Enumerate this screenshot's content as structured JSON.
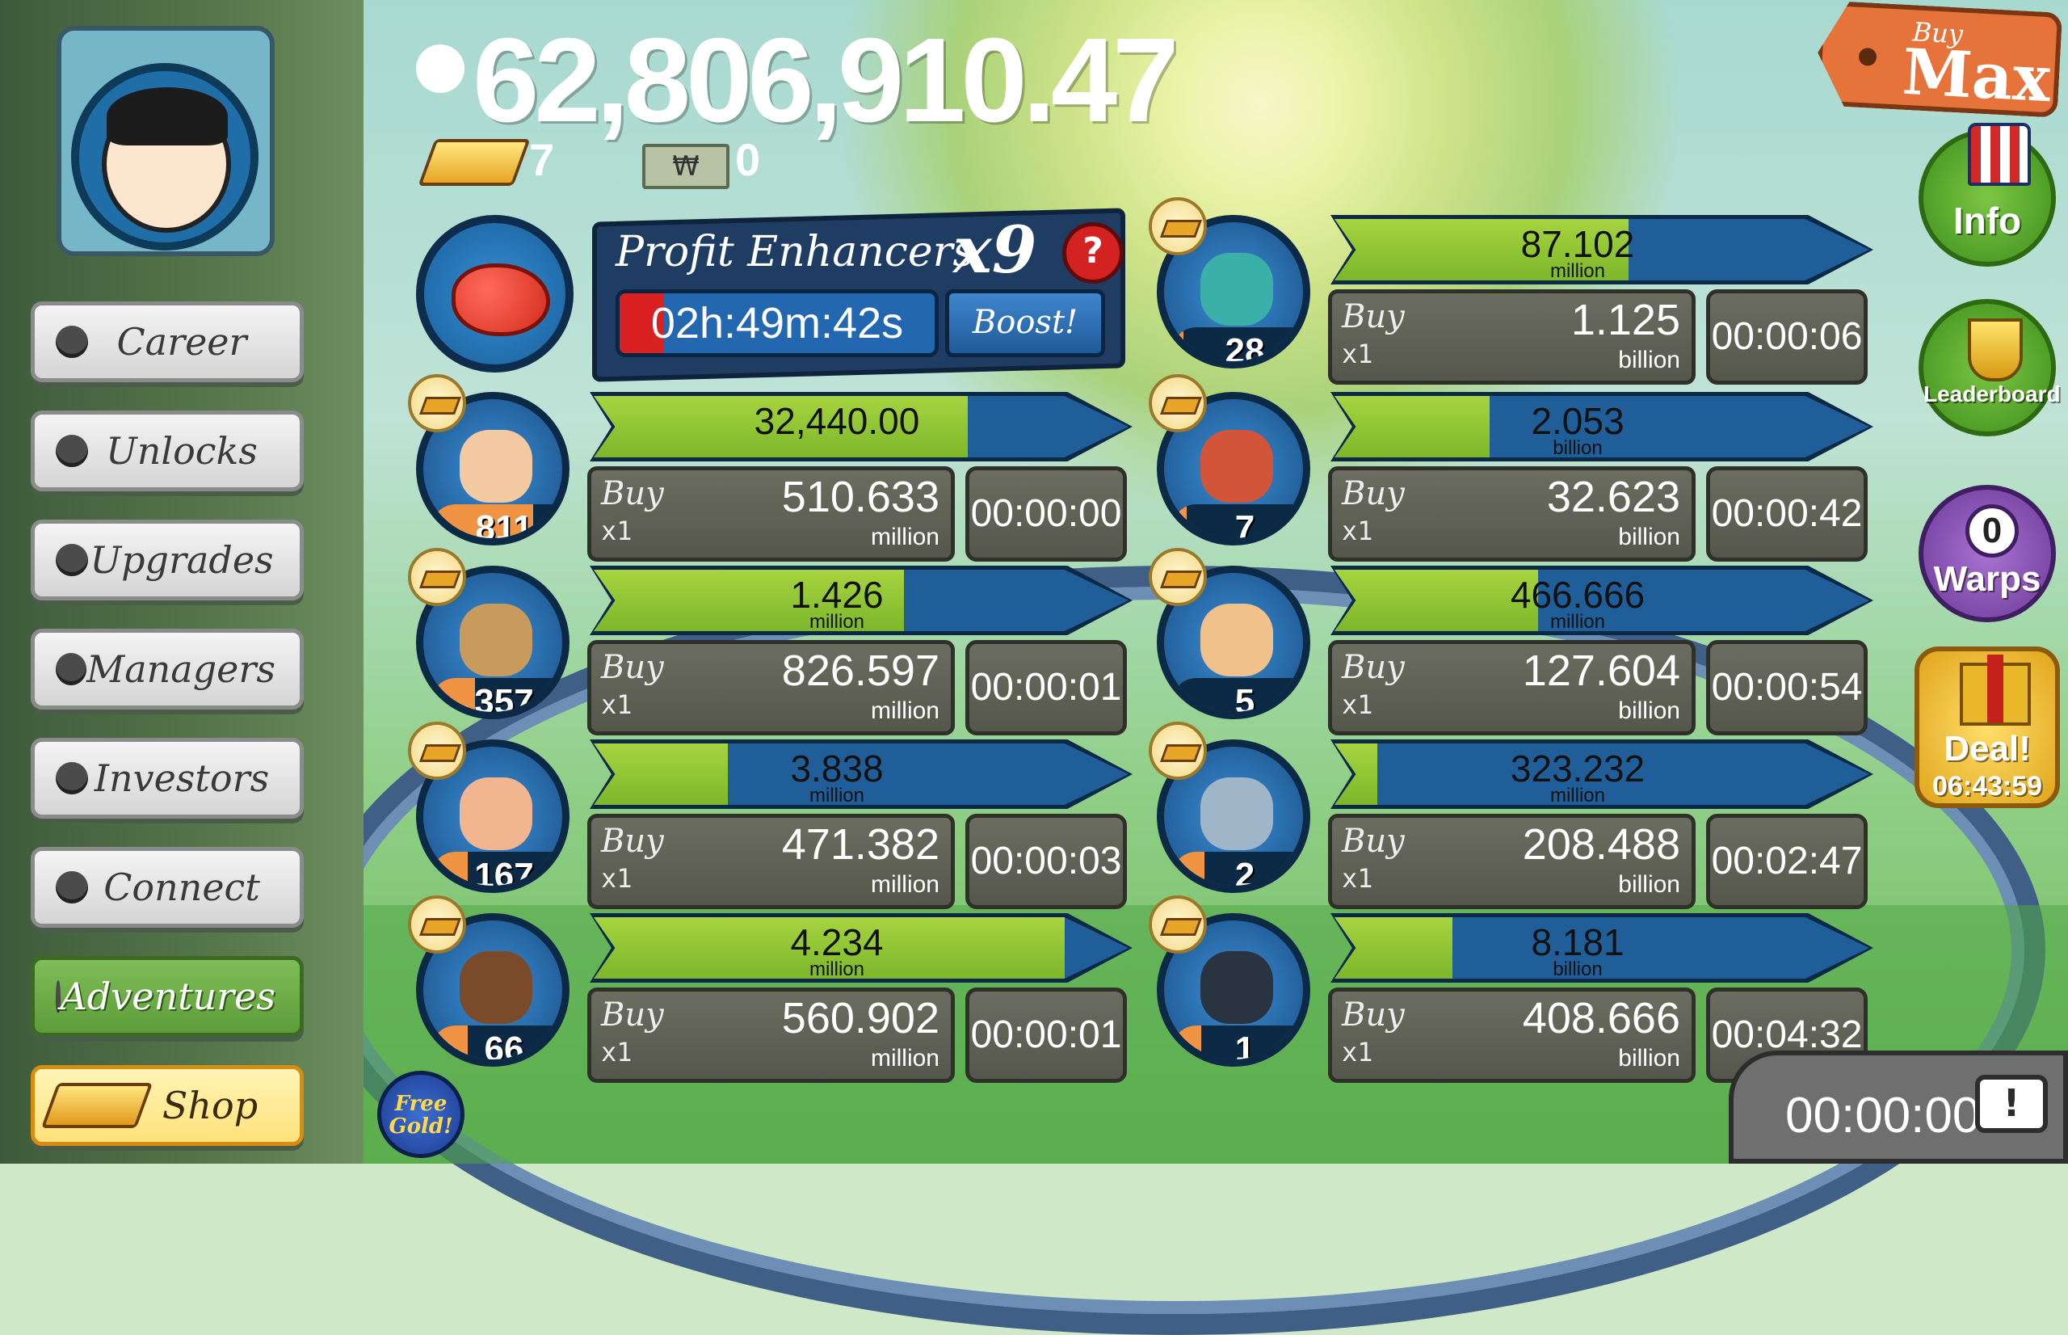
{
  "currency": {
    "money": "62,806,910.47",
    "gold_bars": "7",
    "megabucks": "0",
    "megabucks_symbol": "₩"
  },
  "menu": {
    "items": [
      "Career",
      "Unlocks",
      "Upgrades",
      "Managers",
      "Investors",
      "Connect",
      "Adventures"
    ],
    "active": "Adventures",
    "shop_label": "Shop"
  },
  "profit_enhancers": {
    "title": "Profit Enhancers",
    "multiplier": "x9",
    "help": "?",
    "timer": "02h:49m:42s",
    "boost_label": "Boost!"
  },
  "buy_prefix": "Buy",
  "buy_multiplier": "x1",
  "businesses_left": [
    {
      "icon": "wrestler-dive-icon",
      "count": "811",
      "count_fill": 0.7,
      "revenue": "32,440.00",
      "revenue_unit": "",
      "progress": 0.7,
      "cost": "510.633",
      "cost_unit": "million",
      "timer": "00:00:00"
    },
    {
      "icon": "cardboard-knight-icon",
      "count": "357",
      "count_fill": 0.3,
      "revenue": "1.426",
      "revenue_unit": "million",
      "progress": 0.58,
      "cost": "826.597",
      "cost_unit": "million",
      "timer": "00:00:01"
    },
    {
      "icon": "fist-icon",
      "count": "167",
      "count_fill": 0.25,
      "revenue": "3.838",
      "revenue_unit": "million",
      "progress": 0.25,
      "cost": "471.382",
      "cost_unit": "million",
      "timer": "00:00:03"
    },
    {
      "icon": "boxing-bear-icon",
      "count": "66",
      "count_fill": 0.25,
      "revenue": "4.234",
      "revenue_unit": "million",
      "progress": 0.88,
      "cost": "560.902",
      "cost_unit": "million",
      "timer": "00:00:01"
    }
  ],
  "businesses_right": [
    {
      "icon": "masked-wrestler-icon",
      "count": "28",
      "count_fill": 0.08,
      "revenue": "87.102",
      "revenue_unit": "million",
      "progress": 0.55,
      "cost": "1.125",
      "cost_unit": "billion",
      "timer": "00:00:06"
    },
    {
      "icon": "bull-icon",
      "count": "7",
      "count_fill": 0.1,
      "revenue": "2.053",
      "revenue_unit": "billion",
      "progress": 0.29,
      "cost": "32.623",
      "cost_unit": "billion",
      "timer": "00:00:42"
    },
    {
      "icon": "hotdog-vendor-icon",
      "count": "5",
      "count_fill": 0.05,
      "revenue": "466.666",
      "revenue_unit": "million",
      "progress": 0.38,
      "cost": "127.604",
      "cost_unit": "billion",
      "timer": "00:00:54"
    },
    {
      "icon": "moon-astronaut-icon",
      "count": "2",
      "count_fill": 0.22,
      "revenue": "323.232",
      "revenue_unit": "million",
      "progress": 0.08,
      "cost": "208.488",
      "cost_unit": "billion",
      "timer": "00:02:47"
    },
    {
      "icon": "gamepad-headset-icon",
      "count": "1",
      "count_fill": 0.2,
      "revenue": "8.181",
      "revenue_unit": "billion",
      "progress": 0.22,
      "cost": "408.666",
      "cost_unit": "billion",
      "timer": "00:04:32"
    }
  ],
  "side": {
    "buy_max_top": "Buy",
    "buy_max_bottom": "Max",
    "info": "Info",
    "leaderboard": "Leaderboard",
    "warps_count": "0",
    "warps": "Warps",
    "deal": "Deal!",
    "deal_timer": "06:43:59"
  },
  "free_gold": "Free Gold!",
  "tv_timer": "00:00:00",
  "tv_icon": "!",
  "colors": {
    "progress_fill": "#8cc436",
    "count_fill": "#f09443",
    "panel_blue": "#1f5e99"
  }
}
